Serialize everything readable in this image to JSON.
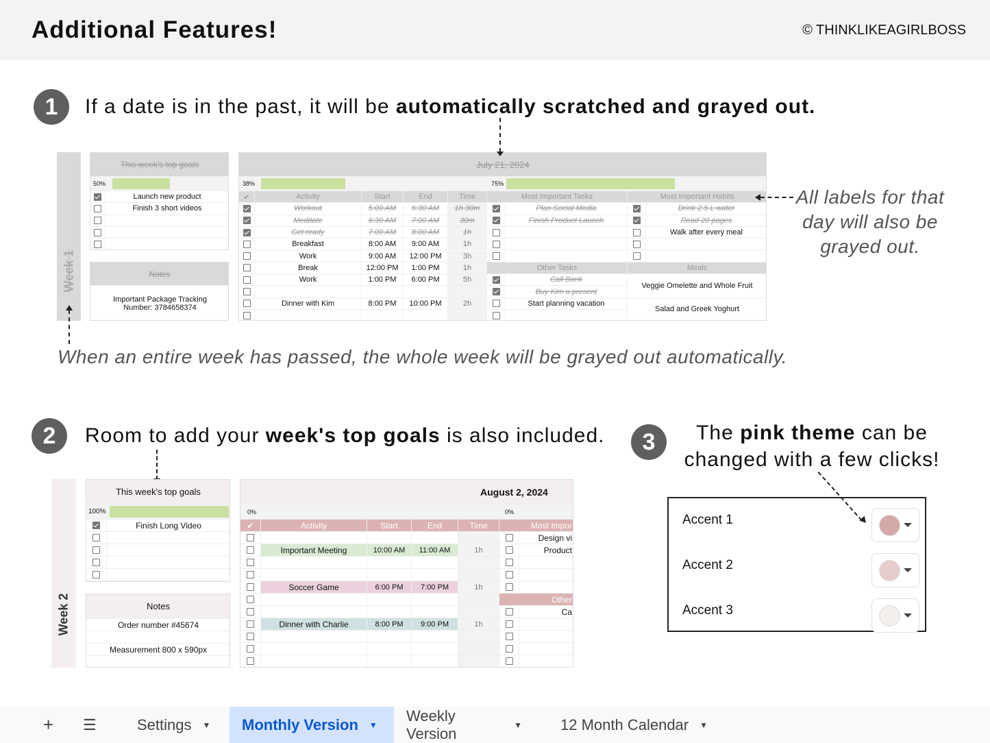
{
  "header": {
    "title": "Additional Features!",
    "copyright": "© THINKLIKEAGIRLBOSS"
  },
  "section1": {
    "number": "1",
    "text_pre": "If a date is in the past, it will be ",
    "text_bold": "automatically scratched and grayed out.",
    "annotation_labels": [
      "All labels for that",
      "day will also be",
      "grayed out."
    ],
    "annotation_week": "When an entire week has passed, the whole week will be grayed out automatically."
  },
  "week1": {
    "label": "Week 1",
    "goals": {
      "title": "This week's top goals",
      "progress_text": "50%",
      "progress": 0.5,
      "items": [
        {
          "checked": true,
          "text": "Launch new product"
        },
        {
          "checked": false,
          "text": "Finish 3 short videos"
        },
        {
          "checked": false,
          "text": ""
        },
        {
          "checked": false,
          "text": ""
        },
        {
          "checked": false,
          "text": ""
        }
      ]
    },
    "notes": {
      "title": "Notes",
      "lines": [
        "Important Package Tracking",
        "Number: 3784658374"
      ]
    },
    "day": {
      "date": "July 21, 2024",
      "progress_left_text": "38%",
      "progress_left": 0.38,
      "progress_right_text": "75%",
      "progress_right": 0.75,
      "headers": {
        "check": "✔",
        "activity": "Activity",
        "start": "Start",
        "end": "End",
        "time": "Time",
        "mit": "Most Important Tasks",
        "habits": "Most Important Habits",
        "other": "Other Tasks",
        "meals": "Meals"
      },
      "schedule": [
        {
          "checked": true,
          "activity": "Workout",
          "start": "5:00 AM",
          "end": "6:30 AM",
          "time": "1h 30m",
          "past": true
        },
        {
          "checked": true,
          "activity": "Meditate",
          "start": "6:30 AM",
          "end": "7:00 AM",
          "time": "30m",
          "past": true
        },
        {
          "checked": true,
          "activity": "Get ready",
          "start": "7:00 AM",
          "end": "8:00 AM",
          "time": "1h",
          "past": true
        },
        {
          "checked": false,
          "activity": "Breakfast",
          "start": "8:00 AM",
          "end": "9:00 AM",
          "time": "1h"
        },
        {
          "checked": false,
          "activity": "Work",
          "start": "9:00 AM",
          "end": "12:00 PM",
          "time": "3h"
        },
        {
          "checked": false,
          "activity": "Break",
          "start": "12:00 PM",
          "end": "1:00 PM",
          "time": "1h"
        },
        {
          "checked": false,
          "activity": "Work",
          "start": "1:00 PM",
          "end": "6:00 PM",
          "time": "5h"
        },
        {
          "checked": false,
          "activity": "",
          "start": "",
          "end": "",
          "time": ""
        },
        {
          "checked": false,
          "activity": "Dinner with Kim",
          "start": "8:00 PM",
          "end": "10:00 PM",
          "time": "2h"
        },
        {
          "checked": false,
          "activity": "",
          "start": "",
          "end": "",
          "time": ""
        }
      ],
      "mit": [
        {
          "checked": true,
          "text": "Plan Social Media",
          "past": true
        },
        {
          "checked": true,
          "text": "Finish Product Launch",
          "past": true
        },
        {
          "checked": false,
          "text": ""
        },
        {
          "checked": false,
          "text": ""
        },
        {
          "checked": false,
          "text": ""
        }
      ],
      "habits": [
        {
          "checked": true,
          "text": "Drink 2.5 L water",
          "past": true
        },
        {
          "checked": true,
          "text": "Read 20 pages",
          "past": true
        },
        {
          "checked": false,
          "text": "Walk after every meal"
        },
        {
          "checked": false,
          "text": ""
        },
        {
          "checked": false,
          "text": ""
        }
      ],
      "other": [
        {
          "checked": true,
          "text": "Call Bank",
          "past": true
        },
        {
          "checked": true,
          "text": "Buy Kim a present",
          "past": true
        },
        {
          "checked": false,
          "text": "Start planning vacation"
        },
        {
          "checked": false,
          "text": ""
        }
      ],
      "meals": [
        "Veggie Omelette and Whole Fruit",
        "Salad and Greek Yoghurt"
      ]
    }
  },
  "section2": {
    "number": "2",
    "text_pre": "Room to add your ",
    "text_bold": "week's top goals",
    "text_post": " is also included."
  },
  "week2": {
    "label": "Week 2",
    "goals": {
      "title": "This week's top goals",
      "progress_text": "100%",
      "progress": 1.0,
      "items": [
        {
          "checked": true,
          "text": "Finish Long Video"
        },
        {
          "checked": false,
          "text": ""
        },
        {
          "checked": false,
          "text": ""
        },
        {
          "checked": false,
          "text": ""
        },
        {
          "checked": false,
          "text": ""
        }
      ]
    },
    "notes": {
      "title": "Notes",
      "lines": [
        "Order number #45674",
        "",
        "Measurement 800 x 590px",
        ""
      ]
    },
    "day": {
      "date": "August 2, 2024",
      "progress_left_text": "0%",
      "progress_right_text": "0%",
      "headers": {
        "check": "✔",
        "activity": "Activity",
        "start": "Start",
        "end": "End",
        "time": "Time",
        "mit": "Most Impor",
        "other": "Other"
      },
      "schedule": [
        {
          "activity": "",
          "start": "",
          "end": "",
          "time": ""
        },
        {
          "activity": "Important Meeting",
          "start": "10:00 AM",
          "end": "11:00 AM",
          "time": "1h",
          "color": "#d9ead3"
        },
        {
          "activity": "",
          "start": "",
          "end": "",
          "time": ""
        },
        {
          "activity": "",
          "start": "",
          "end": "",
          "time": ""
        },
        {
          "activity": "Soccer Game",
          "start": "6:00 PM",
          "end": "7:00 PM",
          "time": "1h",
          "color": "#ead1dc"
        },
        {
          "activity": "",
          "start": "",
          "end": "",
          "time": ""
        },
        {
          "activity": "",
          "start": "",
          "end": "",
          "time": ""
        },
        {
          "activity": "Dinner with Charlie",
          "start": "8:00 PM",
          "end": "9:00 PM",
          "time": "1h",
          "color": "#d0e0e3"
        },
        {
          "activity": "",
          "start": "",
          "end": "",
          "time": ""
        },
        {
          "activity": "",
          "start": "",
          "end": "",
          "time": ""
        },
        {
          "activity": "",
          "start": "",
          "end": "",
          "time": ""
        }
      ],
      "mit": [
        "Design vi",
        "Product",
        "",
        "",
        ""
      ],
      "other": [
        "Ca",
        "",
        "",
        "",
        ""
      ]
    }
  },
  "section3": {
    "number": "3",
    "line1_pre": "The ",
    "line1_bold": "pink theme",
    "line1_post": " can be",
    "line2": "changed with a few clicks!",
    "accents": [
      {
        "label": "Accent 1",
        "color": "#d4a9a7"
      },
      {
        "label": "Accent 2",
        "color": "#e6cccb"
      },
      {
        "label": "Accent 3",
        "color": "#f4eeed"
      }
    ]
  },
  "theme": {
    "accent_pink": "#dcb3b3",
    "light_pink": "#f4eeee",
    "gray": "#d9d9d9",
    "progress_green": "#c9e0a0"
  },
  "tabs": {
    "add": "+",
    "menu": "☰",
    "items": [
      {
        "label": "Settings",
        "active": false
      },
      {
        "label": "Monthly Version",
        "active": true
      },
      {
        "label": "Weekly Version",
        "active": false
      },
      {
        "label": "12 Month Calendar",
        "active": false
      }
    ]
  }
}
